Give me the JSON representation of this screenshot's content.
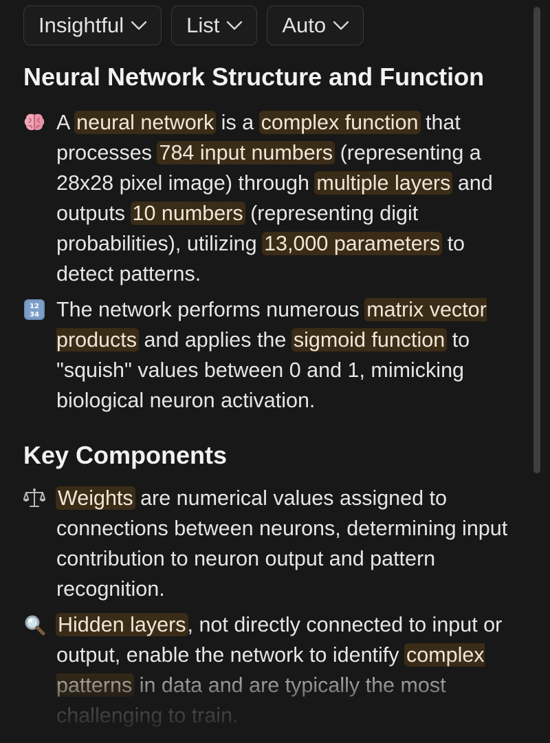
{
  "toolbar": {
    "dropdowns": [
      {
        "label": "Insightful"
      },
      {
        "label": "List"
      },
      {
        "label": "Auto"
      }
    ]
  },
  "sections": [
    {
      "title": "Neural Network Structure and Function",
      "items": [
        {
          "icon": "brain-icon",
          "segments": [
            {
              "t": "A "
            },
            {
              "t": "neural network",
              "hl": true
            },
            {
              "t": " is a "
            },
            {
              "t": "complex function",
              "hl": true
            },
            {
              "t": " that processes "
            },
            {
              "t": "784 input numbers",
              "hl": true
            },
            {
              "t": " (representing a 28x28 pixel image) through "
            },
            {
              "t": "multiple layers",
              "hl": true
            },
            {
              "t": " and outputs "
            },
            {
              "t": "10 numbers",
              "hl": true
            },
            {
              "t": " (representing digit probabilities), utilizing "
            },
            {
              "t": "13,000 parameters",
              "hl": true
            },
            {
              "t": " to detect patterns."
            }
          ]
        },
        {
          "icon": "numbers-icon",
          "segments": [
            {
              "t": "The network performs numerous "
            },
            {
              "t": "matrix vector products",
              "hl": true
            },
            {
              "t": " and applies the "
            },
            {
              "t": "sigmoid function",
              "hl": true
            },
            {
              "t": " to \"squish\" values between 0 and 1, mimicking biological neuron activation."
            }
          ]
        }
      ]
    },
    {
      "title": "Key Components",
      "items": [
        {
          "icon": "balance-scale-icon",
          "segments": [
            {
              "t": "Weights",
              "hl": true
            },
            {
              "t": " are numerical values assigned to connections between neurons, determining input contribution to neuron output and pattern recognition."
            }
          ]
        },
        {
          "icon": "magnifying-glass-icon",
          "segments": [
            {
              "t": "Hidden layers",
              "hl": true
            },
            {
              "t": ", not directly connected to input or output, enable the network to identify "
            },
            {
              "t": "complex patterns",
              "hl": true
            },
            {
              "t": " in data and are typically the most challenging to train."
            }
          ]
        }
      ]
    }
  ],
  "colors": {
    "background": "#181818",
    "highlight": "#3b2c17",
    "text": "#e6e6e6"
  }
}
